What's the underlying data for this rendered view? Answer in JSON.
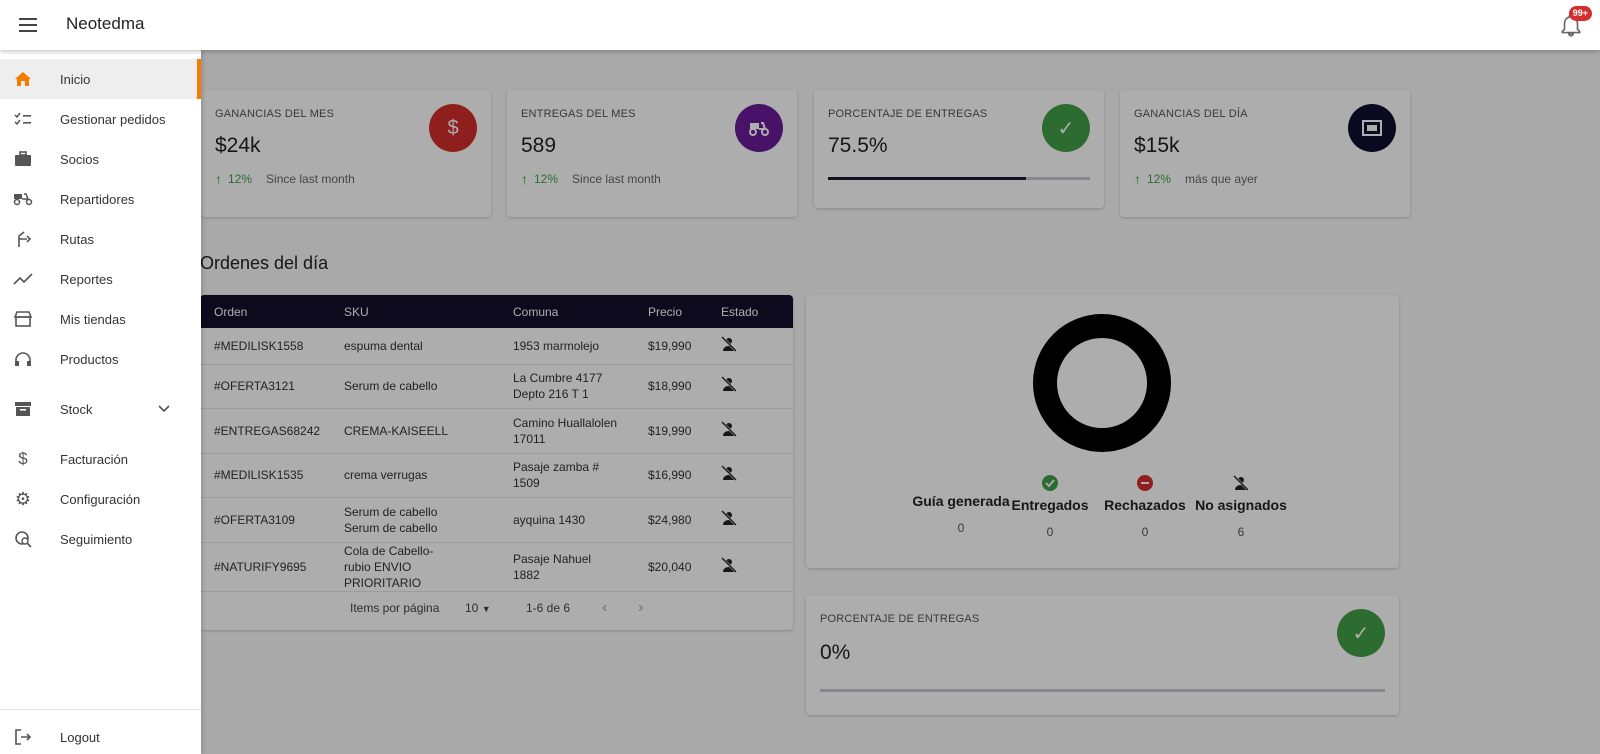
{
  "app": {
    "title": "Neotedma",
    "notifications_badge": "99+"
  },
  "colors": {
    "accent": "#f57c00",
    "header_dark": "#12102a",
    "green": "#43a047",
    "red": "#d32f2f",
    "purple": "#6a1b9a",
    "navy": "#0f0e2e"
  },
  "sidebar": {
    "items": [
      {
        "label": "Inicio",
        "icon": "home-icon",
        "active": true
      },
      {
        "label": "Gestionar pedidos",
        "icon": "checklist-icon"
      },
      {
        "label": "Socios",
        "icon": "briefcase-icon"
      },
      {
        "label": "Repartidores",
        "icon": "scooter-icon"
      },
      {
        "label": "Rutas",
        "icon": "route-icon"
      },
      {
        "label": "Reportes",
        "icon": "trending-icon"
      },
      {
        "label": "Mis tiendas",
        "icon": "store-icon"
      },
      {
        "label": "Productos",
        "icon": "headphones-icon"
      },
      {
        "label": "Stock",
        "icon": "archive-icon"
      },
      {
        "label": "Facturación",
        "icon": "dollar-icon"
      },
      {
        "label": "Configuración",
        "icon": "gear-icon"
      },
      {
        "label": "Seguimiento",
        "icon": "track-icon"
      }
    ],
    "logout": "Logout"
  },
  "stats": [
    {
      "label": "GANANCIAS DEL MES",
      "value": "$24k",
      "pct": "12%",
      "note": "Since last month",
      "icon": "dollar-icon"
    },
    {
      "label": "ENTREGAS DEL MES",
      "value": "589",
      "pct": "12%",
      "note": "Since last month",
      "icon": "scooter-icon"
    },
    {
      "label": "PORCENTAJE DE ENTREGAS",
      "value": "75.5%",
      "progress": 0.755,
      "icon": "check-icon"
    },
    {
      "label": "GANANCIAS DEL DÍA",
      "value": "$15k",
      "pct": "12%",
      "note": "más que ayer",
      "icon": "money-icon"
    }
  ],
  "orders": {
    "title": "Ordenes del día",
    "columns": [
      "Orden",
      "SKU",
      "Comuna",
      "Precio",
      "Estado"
    ],
    "rows": [
      {
        "orden": "#MEDILISK1558",
        "sku": "espuma dental",
        "comuna": "1953 marmolejo",
        "precio": "$19,990"
      },
      {
        "orden": "#OFERTA3121",
        "sku": "Serum de cabello",
        "comuna": "La Cumbre 4177 Depto 216 T 1",
        "precio": "$18,990"
      },
      {
        "orden": "#ENTREGAS68242",
        "sku": "CREMA-KAISEELL",
        "comuna": "Camino Huallalolen 17011",
        "precio": "$19,990"
      },
      {
        "orden": "#MEDILISK1535",
        "sku": "crema verrugas",
        "comuna": "Pasaje zamba # 1509",
        "precio": "$16,990"
      },
      {
        "orden": "#OFERTA3109",
        "sku": "Serum de cabello Serum de cabello",
        "comuna": "ayquina 1430",
        "precio": "$24,980"
      },
      {
        "orden": "#NATURIFY9695",
        "sku": "Cola de Cabello-rubio ENVIO PRIORITARIO",
        "comuna": "Pasaje Nahuel 1882",
        "precio": "$20,040"
      }
    ],
    "pager": {
      "items_label": "Items por página",
      "per_page": "10",
      "range": "1-6 de 6"
    }
  },
  "chart_data": {
    "type": "pie",
    "categories": [
      "Guía generada",
      "Entregados",
      "Rechazados",
      "No asignados"
    ],
    "values": [
      0,
      0,
      0,
      6
    ]
  },
  "pct_card": {
    "label": "PORCENTAJE DE ENTREGAS",
    "value": "0%",
    "progress": 0
  }
}
